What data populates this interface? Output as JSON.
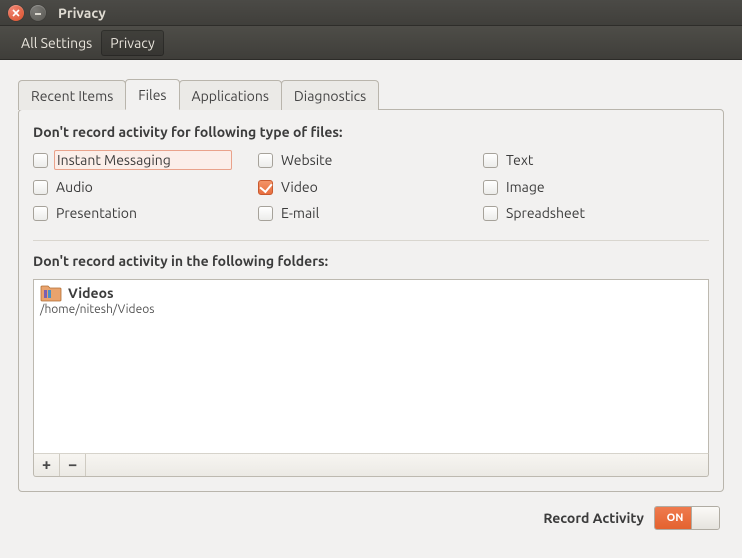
{
  "window": {
    "title": "Privacy"
  },
  "breadcrumb": {
    "all": "All Settings",
    "current": "Privacy"
  },
  "tabs": {
    "recent": "Recent Items",
    "files": "Files",
    "apps": "Applications",
    "diag": "Diagnostics"
  },
  "section1_label": "Don't record activity for following type of files:",
  "filetypes": {
    "im": {
      "label": "Instant Messaging",
      "checked": false,
      "highlight": true
    },
    "website": {
      "label": "Website",
      "checked": false
    },
    "text": {
      "label": "Text",
      "checked": false
    },
    "audio": {
      "label": "Audio",
      "checked": false
    },
    "video": {
      "label": "Video",
      "checked": true
    },
    "image": {
      "label": "Image",
      "checked": false
    },
    "presentation": {
      "label": "Presentation",
      "checked": false
    },
    "email": {
      "label": "E-mail",
      "checked": false
    },
    "spreadsheet": {
      "label": "Spreadsheet",
      "checked": false
    }
  },
  "section2_label": "Don't record activity in the following folders:",
  "folders": [
    {
      "name": "Videos",
      "path": "/home/nitesh/Videos"
    }
  ],
  "buttons": {
    "add": "+",
    "remove": "−"
  },
  "footer": {
    "label": "Record Activity",
    "switch": "ON"
  }
}
